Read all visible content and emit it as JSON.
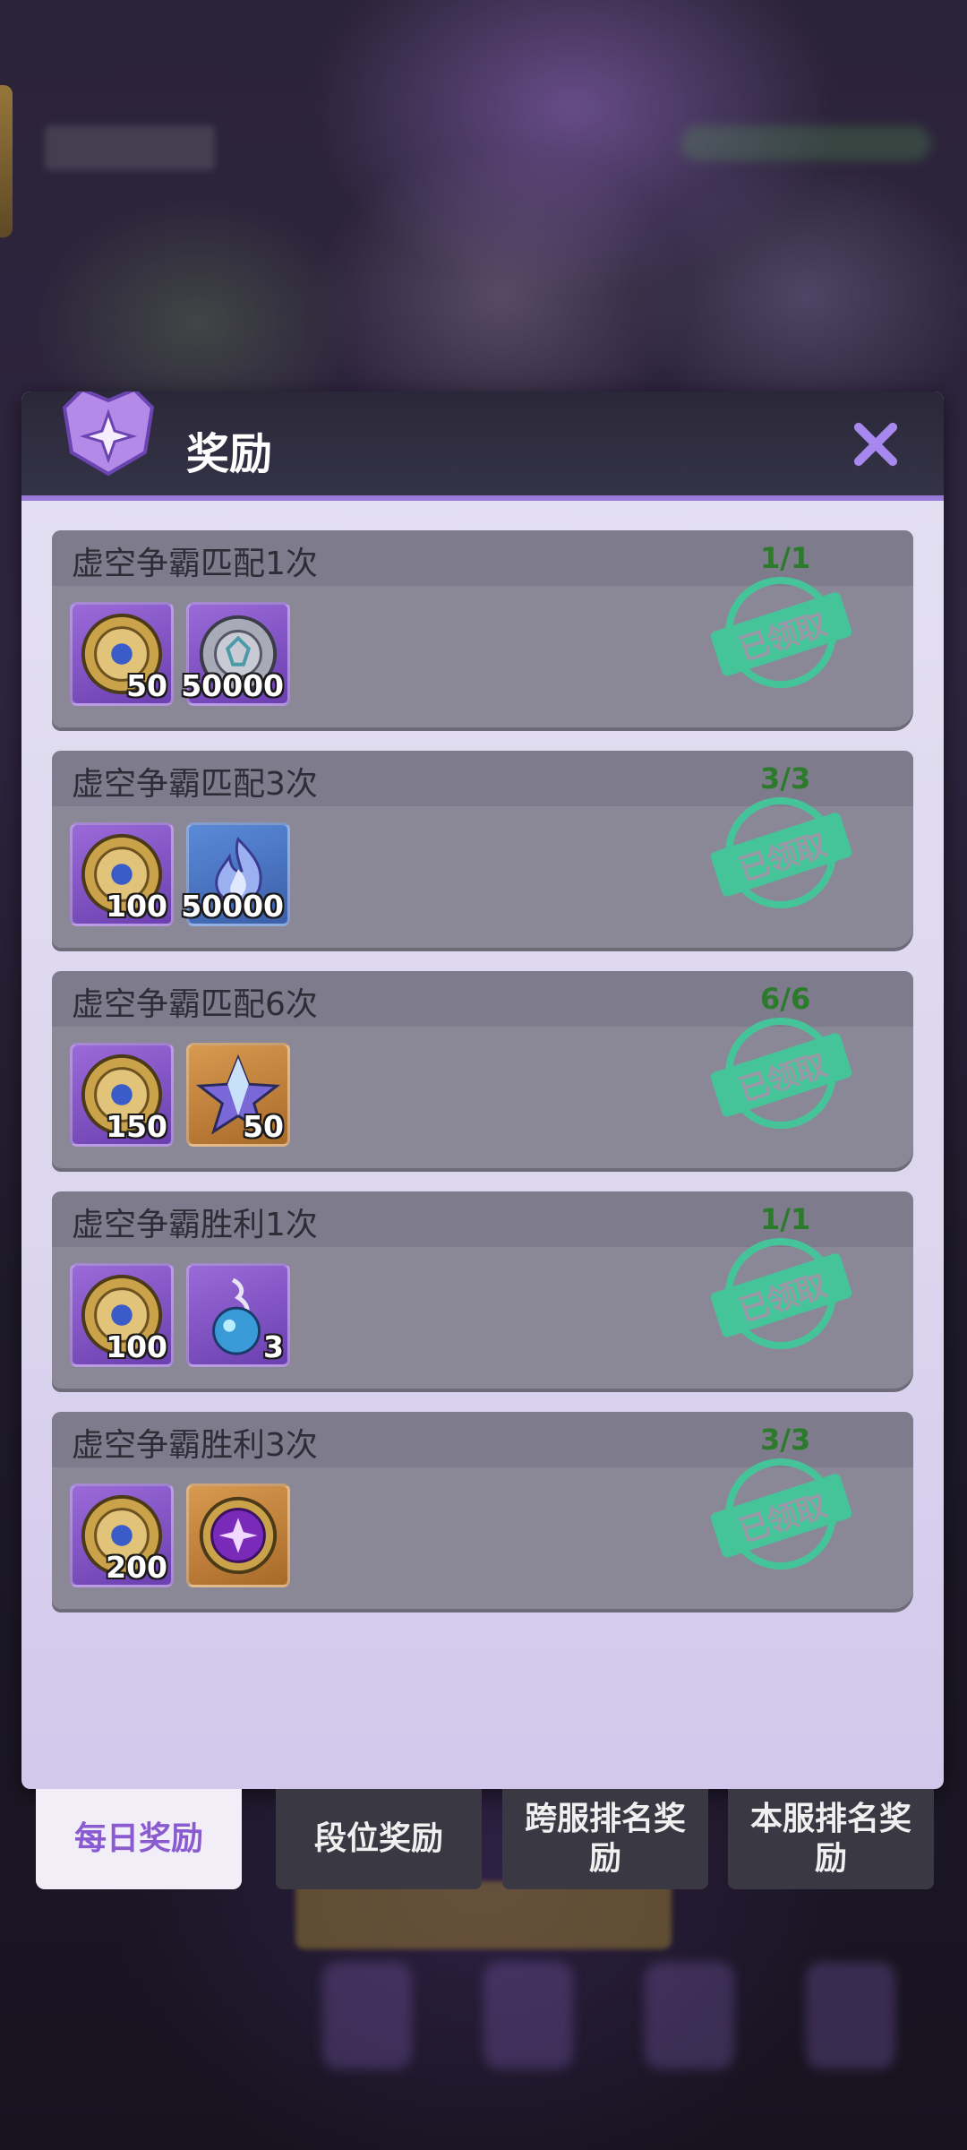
{
  "panel": {
    "title": "奖励"
  },
  "tasks": [
    {
      "title": "虚空争霸匹配1次",
      "progress": "1/1",
      "stamp": "已领取",
      "rewards": [
        {
          "icon": "gold-medal-coin-icon",
          "bg": "purple",
          "qty": "50"
        },
        {
          "icon": "silver-rune-coin-icon",
          "bg": "purple",
          "qty": "50000"
        }
      ]
    },
    {
      "title": "虚空争霸匹配3次",
      "progress": "3/3",
      "stamp": "已领取",
      "rewards": [
        {
          "icon": "gold-medal-coin-icon",
          "bg": "purple",
          "qty": "100"
        },
        {
          "icon": "soul-flame-icon",
          "bg": "blue",
          "qty": "50000"
        }
      ]
    },
    {
      "title": "虚空争霸匹配6次",
      "progress": "6/6",
      "stamp": "已领取",
      "rewards": [
        {
          "icon": "gold-medal-coin-icon",
          "bg": "purple",
          "qty": "150"
        },
        {
          "icon": "crystal-star-icon",
          "bg": "gold",
          "qty": "50"
        }
      ]
    },
    {
      "title": "虚空争霸胜利1次",
      "progress": "1/1",
      "stamp": "已领取",
      "rewards": [
        {
          "icon": "gold-medal-coin-icon",
          "bg": "purple",
          "qty": "100"
        },
        {
          "icon": "spirit-potion-icon",
          "bg": "purple",
          "qty": "3"
        }
      ]
    },
    {
      "title": "虚空争霸胜利3次",
      "progress": "3/3",
      "stamp": "已领取",
      "rewards": [
        {
          "icon": "gold-medal-coin-icon",
          "bg": "purple",
          "qty": "200"
        },
        {
          "icon": "void-emblem-icon",
          "bg": "gold",
          "qty": ""
        }
      ]
    }
  ],
  "tabs": [
    {
      "label": "每日奖励",
      "active": true
    },
    {
      "label": "段位奖励",
      "active": false
    },
    {
      "label": "跨服排名奖励",
      "active": false
    },
    {
      "label": "本服排名奖励",
      "active": false
    }
  ],
  "colors": {
    "accent": "#9a7ad8",
    "progress_green": "#2c7a2c",
    "stamp_green": "#45c49a",
    "active_tab_text": "#8a5ad0"
  }
}
